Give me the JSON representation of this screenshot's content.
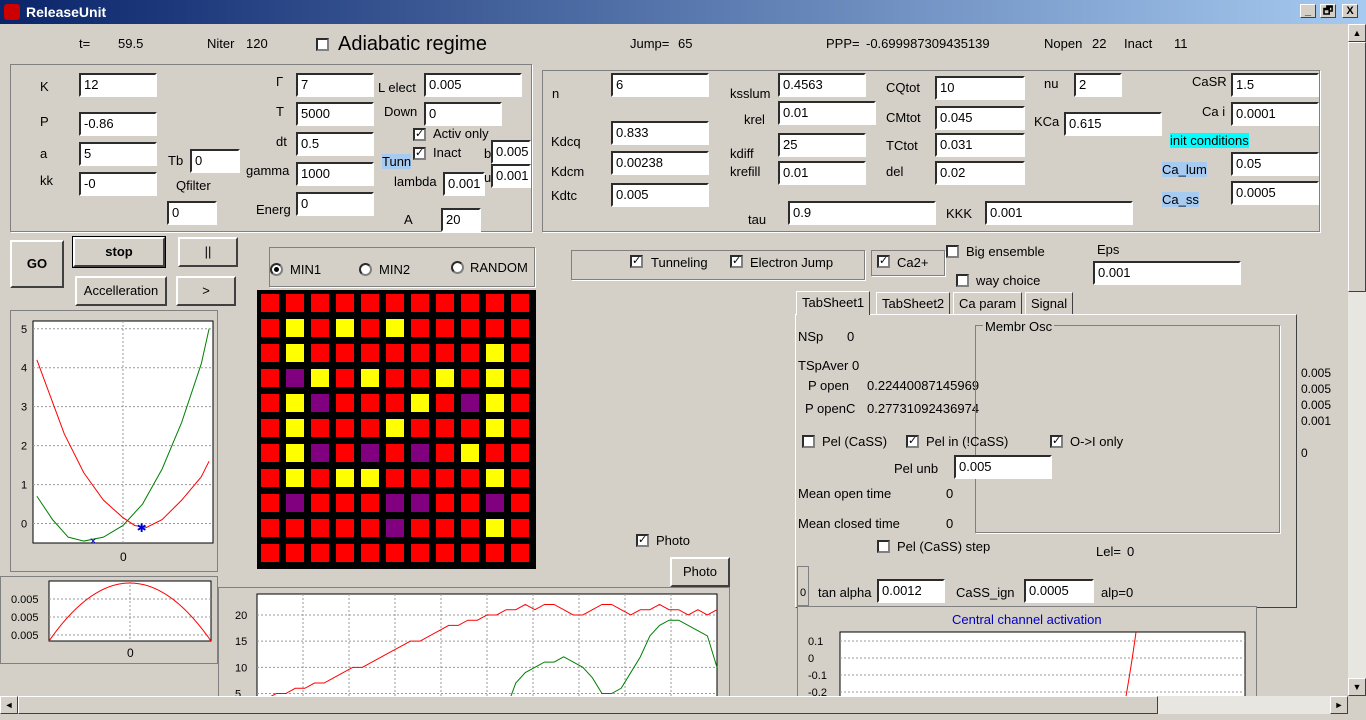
{
  "title": "ReleaseUnit",
  "window": {
    "min": "_",
    "max": "🗗",
    "close": "X"
  },
  "top": {
    "t_label": "t=",
    "t_value": "59.5",
    "niter_label": "Niter",
    "niter_value": "120",
    "adiabatic": "Adiabatic regime",
    "jump_label": "Jump=",
    "jump_value": "65",
    "ppp_label": "PPP=",
    "ppp_value": "-0.699987309435139",
    "nopen_label": "Nopen",
    "nopen_value": "22",
    "inact_label": "Inact",
    "inact_value": "11"
  },
  "p1": {
    "K": "K",
    "K_v": "12",
    "P": "P",
    "P_v": "-0.86",
    "a": "a",
    "a_v": "5",
    "kk": "kk",
    "kk_v": "-0",
    "Tb": "Tb",
    "Tb_v": "0",
    "Qfilter": "Qfilter",
    "Qfilter_v": "0",
    "G": "Γ",
    "G_v": "7",
    "T": "T",
    "T_v": "5000",
    "dt": "dt",
    "dt_v": "0.5",
    "gamma": "gamma",
    "gamma_v": "1000",
    "Energ": "Energ",
    "Energ_v": "0",
    "Lelect": "L elect",
    "Lelect_v": "0.005",
    "Down": "Down",
    "Down_v": "0",
    "activ": "Activ only",
    "inact": "Inact",
    "tunn": "Tunn",
    "lambda": "lambda",
    "lambda_v": "0.001",
    "b": "b",
    "b_v": "0.005",
    "u": "u",
    "u_v": "0.001",
    "A": "A",
    "A_v": "20"
  },
  "p2": {
    "n": "n",
    "n_v": "6",
    "Kdcq": "Kdcq",
    "Kdcq_v": "0.833",
    "Kdcm": "Kdcm",
    "Kdcm_v": "0.00238",
    "Kdtc": "Kdtc",
    "Kdtc_v": "0.005",
    "ksslum": "ksslum",
    "ksslum_v": "0.4563",
    "krel": "krel",
    "krel_v": "0.01",
    "kdiff": "kdiff",
    "kdiff_v": "25",
    "krefill": "krefill",
    "krefill_v": "0.01",
    "tau": "tau",
    "tau_v": "0.9",
    "CQtot": "CQtot",
    "CQtot_v": "10",
    "CMtot": "CMtot",
    "CMtot_v": "0.045",
    "TCtot": "TCtot",
    "TCtot_v": "0.031",
    "del": "del",
    "del_v": "0.02",
    "KKK": "KKK",
    "KKK_v": "0.001",
    "nu": "nu",
    "nu_v": "2",
    "KCa": "KCa",
    "KCa_v": "0.615",
    "CaSR": "CaSR",
    "CaSR_v": "1.5",
    "Cai": "Ca i",
    "Cai_v": "0.0001",
    "init": "init conditions",
    "Calum": "Ca_lum",
    "Calum_v": "0.05",
    "Cass": "Ca_ss",
    "Cass_v": "0.0005"
  },
  "controls": {
    "go": "GO",
    "stop": "stop",
    "pause": "||",
    "accel": "Accelleration",
    "next": ">",
    "min1": "MIN1",
    "min2": "MIN2",
    "random": "RANDOM",
    "tunneling": "Tunneling",
    "ejump": "Electron Jump",
    "ca2": "Ca2+",
    "big": "Big ensemble",
    "way": "way choice",
    "eps": "Eps",
    "eps_v": "0.001",
    "photo_cb": "Photo",
    "photo_btn": "Photo"
  },
  "tabs": [
    "TabSheet1",
    "TabSheet2",
    "Ca param",
    "Signal"
  ],
  "tab1": {
    "nsp": "NSp",
    "nsp_v": "0",
    "tsp": "TSpAver 0",
    "popen": "P open",
    "popen_v": "0.22440087145969",
    "popenc": "P openC",
    "popenc_v": "0.27731092436974",
    "membr": "Membr Osc",
    "pel_cass": "Pel (CaSS)",
    "pel_in": "Pel in (!CaSS)",
    "oi": "O->I only",
    "pelunb": "Pel unb",
    "pelunb_v": "0.005",
    "meanopen": "Mean open time",
    "meanopen_v": "0",
    "meanclosed": "Mean closed time",
    "meanclosed_v": "0",
    "pelstep": "Pel (CaSS) step",
    "lel": "Lel=",
    "lel_v": "0",
    "tanalpha": "tan alpha",
    "tanalpha_v": "0.0012",
    "cassign": "CaSS_ign",
    "cassign_v": "0.0005",
    "alp": "alp=0",
    "slider_v": "0"
  },
  "right_vals": [
    "0.005",
    "0.005",
    "0.005",
    "0.001",
    "0"
  ],
  "central": {
    "title": "Central channel activation",
    "ticks": [
      "0.1",
      "0",
      "-0.1",
      "-0.2"
    ]
  },
  "grid": [
    "RRRRRRRRRRR",
    "RYRYRYRRRRR",
    "RYRRRRRRRYR",
    "RPYRYRRYRYR",
    "RYPRRRYRPYR",
    "RYRRRYRRRYR",
    "RYPRPRPRYRR",
    "RYRYYRRRRYR",
    "RPRRRPPRRPR",
    "RRRRRPRRRYR",
    "RRRRRRRRRRR"
  ],
  "colors": {
    "R": "#ff0000",
    "Y": "#ffff00",
    "P": "#800080"
  },
  "chart_data": [
    {
      "type": "line",
      "yticks": [
        "0",
        "1",
        "2",
        "3",
        "4",
        "5"
      ],
      "xtick": "0",
      "ylim": [
        -0.5,
        5.2
      ],
      "xlim": [
        -2.3,
        2.3
      ],
      "grid": true,
      "series": [
        {
          "color": "#ff0000",
          "points": [
            [
              -2.2,
              4.2
            ],
            [
              -1.5,
              2.3
            ],
            [
              -1,
              1.3
            ],
            [
              -0.5,
              0.6
            ],
            [
              0,
              0.15
            ],
            [
              0.3,
              -0.05
            ],
            [
              0.6,
              -0.1
            ],
            [
              1,
              0.1
            ],
            [
              1.5,
              0.6
            ],
            [
              2,
              1.2
            ],
            [
              2.2,
              1.6
            ]
          ]
        },
        {
          "color": "#008000",
          "points": [
            [
              -2.2,
              0.7
            ],
            [
              -1.8,
              0.1
            ],
            [
              -1.4,
              -0.35
            ],
            [
              -1,
              -0.45
            ],
            [
              -0.5,
              -0.35
            ],
            [
              0,
              -0.05
            ],
            [
              0.5,
              0.5
            ],
            [
              1,
              1.4
            ],
            [
              1.5,
              2.6
            ],
            [
              2,
              4.1
            ],
            [
              2.2,
              5
            ]
          ]
        }
      ],
      "markers": [
        {
          "x": -0.75,
          "y": -0.45,
          "shape": "x"
        },
        {
          "x": 0.45,
          "y": -0.12,
          "shape": "*"
        }
      ]
    },
    {
      "type": "line",
      "yticks": [
        "0.005",
        "0.005",
        "0.005"
      ],
      "xtick": "0",
      "grid": true,
      "series": [
        {
          "color": "#ff0000",
          "shape": "arch"
        }
      ]
    },
    {
      "type": "line",
      "yticks": [
        "20",
        "15",
        "10",
        "5"
      ],
      "ylim": [
        3,
        24
      ],
      "grid": true,
      "series": [
        {
          "color": "#ff0000",
          "values": [
            4,
            4,
            5,
            5,
            6,
            6,
            7,
            7,
            8,
            9,
            10,
            10,
            11,
            12,
            13,
            14,
            15,
            15,
            16,
            17,
            18,
            18,
            19,
            19,
            20,
            20,
            21,
            21,
            22,
            21,
            22,
            22,
            21,
            20,
            20,
            21,
            22,
            22,
            21,
            20,
            21,
            21,
            22,
            21,
            21,
            20,
            21,
            20,
            21
          ]
        },
        {
          "color": "#008000",
          "values": [
            2,
            2,
            2,
            2,
            2,
            2,
            2,
            2,
            2,
            2,
            2,
            2,
            2,
            2,
            2,
            2,
            2,
            2,
            2,
            2,
            2,
            2,
            2,
            2,
            2,
            2,
            2,
            7,
            9,
            10,
            11,
            11,
            12,
            11,
            10,
            8,
            5,
            5,
            6,
            9,
            12,
            16,
            18,
            19,
            19,
            18,
            17,
            16,
            10
          ]
        }
      ]
    }
  ]
}
